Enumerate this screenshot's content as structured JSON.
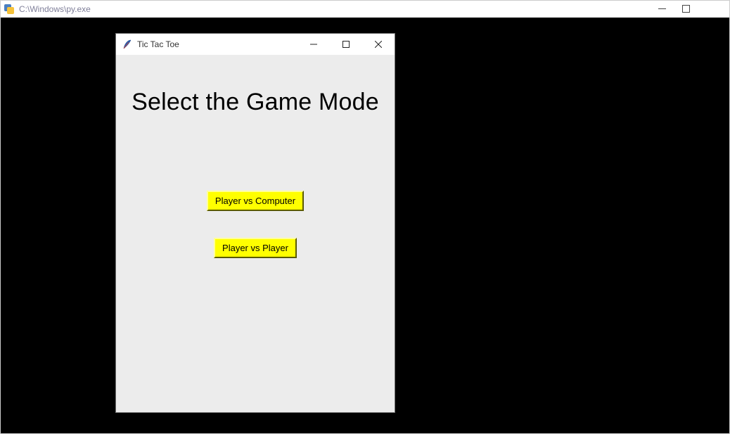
{
  "outer": {
    "title": "C:\\Windows\\py.exe"
  },
  "inner": {
    "title": "Tic Tac Toe",
    "heading": "Select the Game Mode",
    "buttons": {
      "pvc": "Player vs Computer",
      "pvp": "Player vs Player"
    }
  }
}
